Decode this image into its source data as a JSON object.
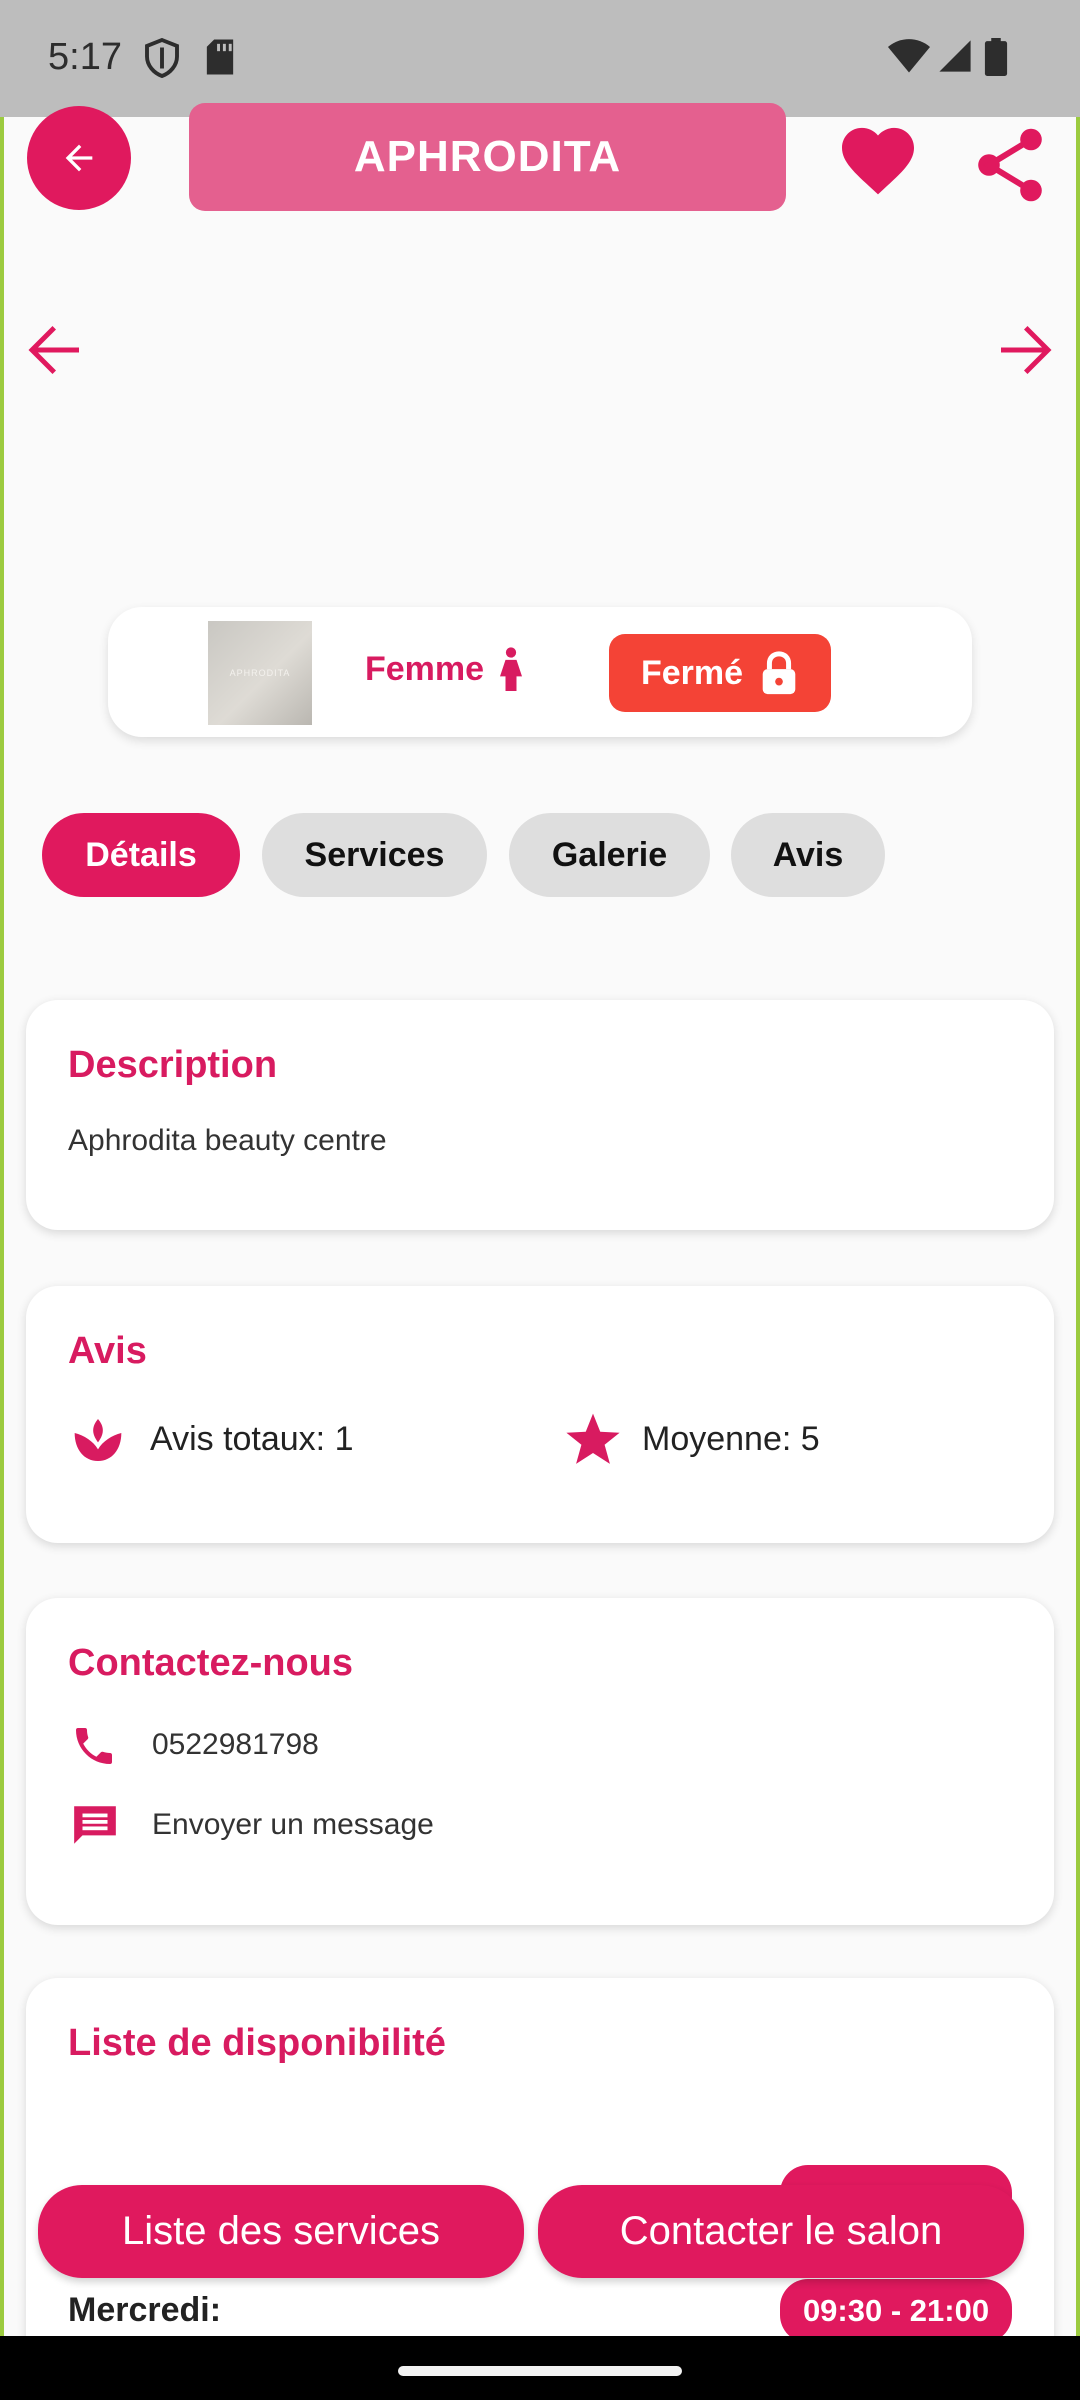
{
  "status_bar": {
    "time": "5:17",
    "icons": [
      "shield-icon",
      "sd-card-icon",
      "wifi-icon",
      "signal-icon",
      "battery-icon"
    ]
  },
  "header": {
    "title": "APHRODITA",
    "back_icon": "arrow-back-icon",
    "favorite_icon": "heart-icon",
    "share_icon": "share-icon"
  },
  "carousel": {
    "prev_icon": "arrow-left-icon",
    "next_icon": "arrow-right-icon"
  },
  "info": {
    "thumbnail_text": "APHRODITA",
    "gender_label": "Femme",
    "status_label": "Fermé"
  },
  "tabs": [
    {
      "label": "Détails",
      "active": true
    },
    {
      "label": "Services",
      "active": false
    },
    {
      "label": "Galerie",
      "active": false
    },
    {
      "label": "Avis",
      "active": false
    }
  ],
  "description": {
    "title": "Description",
    "text": "Aphrodita beauty centre"
  },
  "reviews": {
    "title": "Avis",
    "total_label": "Avis totaux: 1",
    "average_label": "Moyenne: 5"
  },
  "contact": {
    "title": "Contactez-nous",
    "phone": "0522981798",
    "message_label": "Envoyer un message"
  },
  "availability": {
    "title": "Liste de disponibilité",
    "day": "Mercredi:",
    "hours": "09:30 - 21:00"
  },
  "actions": {
    "services_button": "Liste des services",
    "contact_button": "Contacter le salon"
  },
  "colors": {
    "accent": "#e0195e",
    "accent_text": "#d81b60",
    "title_pill": "#e4608f",
    "closed": "#f44336"
  }
}
